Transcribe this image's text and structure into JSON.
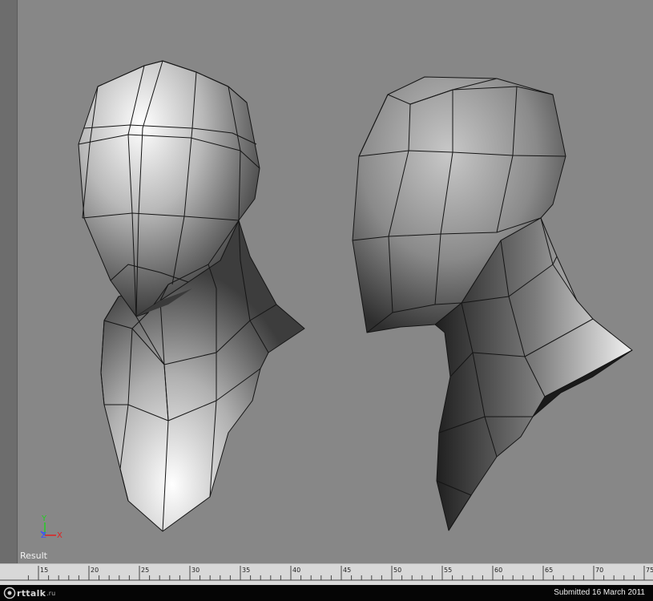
{
  "viewport": {
    "label": "Result",
    "background": "#878787",
    "axes": {
      "y": "Y",
      "z": "Z",
      "x": "X"
    },
    "axis_colors": {
      "x": "#e02020",
      "y": "#22cc22",
      "z": "#3a50ff"
    },
    "models": [
      "head-front-view",
      "head-side-view"
    ]
  },
  "timeline": {
    "ticks": [
      "15",
      "20",
      "25",
      "30",
      "35",
      "40",
      "45",
      "50",
      "55",
      "60",
      "65",
      "70",
      "75"
    ]
  },
  "footer": {
    "logo": {
      "mark": "a",
      "text": "rttalk",
      "tld": ".ru"
    },
    "submitted": "Submitted 16 March 2011"
  }
}
